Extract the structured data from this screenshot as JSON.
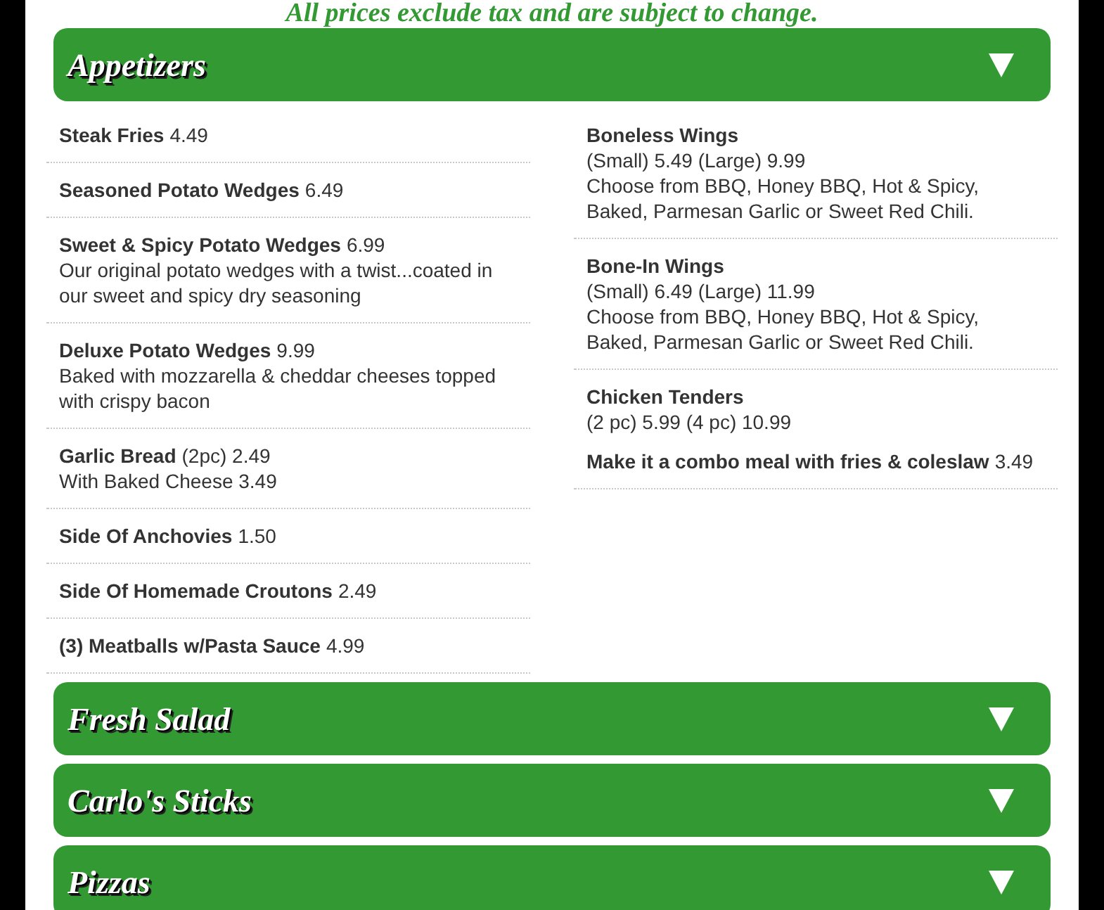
{
  "notice": "All prices exclude tax and are subject to change.",
  "sections": [
    {
      "title": "Appetizers",
      "columns": [
        {
          "items": [
            {
              "name": "Steak Fries",
              "price": "4.49"
            },
            {
              "name": "Seasoned Potato Wedges",
              "price": "6.49"
            },
            {
              "name": "Sweet & Spicy Potato Wedges",
              "price": "6.99",
              "description": "Our original potato wedges with a twist...coated in our sweet and spicy dry seasoning"
            },
            {
              "name": "Deluxe Potato Wedges",
              "price": "9.99",
              "description": "Baked with mozzarella & cheddar cheeses topped with crispy bacon"
            },
            {
              "name": "Garlic Bread",
              "price": "(2pc) 2.49",
              "price_line": "With Baked Cheese 3.49"
            },
            {
              "name": "Side Of Anchovies",
              "price": "1.50"
            },
            {
              "name": "Side Of Homemade Croutons",
              "price": "2.49"
            },
            {
              "name": "(3) Meatballs w/Pasta Sauce",
              "price": "4.99"
            }
          ]
        },
        {
          "items": [
            {
              "name": "Boneless Wings",
              "price_line": "(Small) 5.49 (Large) 9.99",
              "description": "Choose from BBQ, Honey BBQ, Hot & Spicy, Baked, Parmesan Garlic or Sweet Red Chili."
            },
            {
              "name": "Bone-In Wings",
              "price_line": "(Small) 6.49 (Large) 11.99",
              "description": "Choose from BBQ, Honey BBQ, Hot & Spicy, Baked, Parmesan Garlic or Sweet Red Chili."
            },
            {
              "name": "Chicken Tenders",
              "price_line": "(2 pc) 5.99 (4 pc) 10.99",
              "addon": {
                "name": "Make it a combo meal with fries & coleslaw",
                "price": "3.49"
              }
            }
          ]
        }
      ]
    },
    {
      "title": "Fresh Salad"
    },
    {
      "title": "Carlo's Sticks"
    },
    {
      "title": "Pizzas"
    }
  ]
}
